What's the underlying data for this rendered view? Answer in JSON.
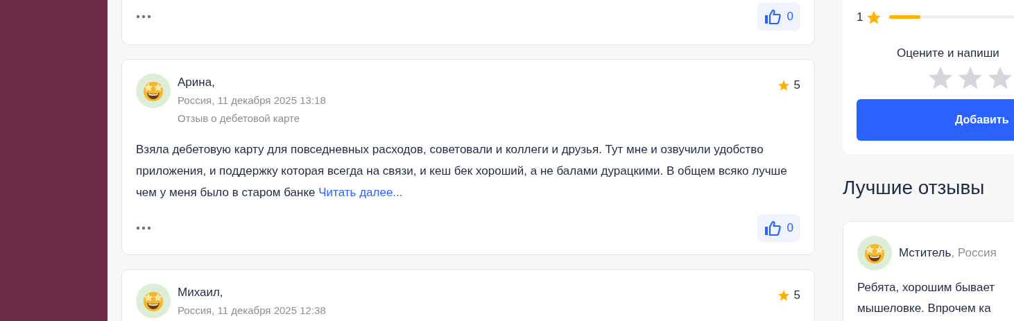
{
  "reviews": [
    {
      "kind": "footer",
      "likes": "0"
    },
    {
      "kind": "full",
      "name": "Арина,",
      "meta": "Россия, 11 декабря 2025 13:18",
      "product": "Отзыв о дебетовой карте",
      "rating": "5",
      "text": "Взяла дебетовую карту для повседневных расходов, советовали и коллеги и друзья. Тут мне и озвучили удобство приложения, и поддержку которая всегда на связи, и кеш бек хороший, а не балами дурацкими. В общем всяко лучше чем у меня было в старом банке",
      "read_more": "Читать далее...",
      "likes": "0"
    },
    {
      "kind": "full",
      "name": "Михаил,",
      "meta": "Россия, 11 декабря 2025 12:38",
      "rating": "5"
    }
  ],
  "sidebar": {
    "rating_row": {
      "label": "1",
      "level": 0.19
    },
    "prompt": "Оцените и напиши",
    "rate_input": {
      "stars": 0
    },
    "add_button": "Добавить",
    "best_title": "Лучшие отзывы",
    "best_review": {
      "name": "Мститель",
      "country": ", Россия",
      "lines": [
        "Ребята, хорошим бывает",
        "мышеловке. Впрочем ка"
      ]
    }
  }
}
